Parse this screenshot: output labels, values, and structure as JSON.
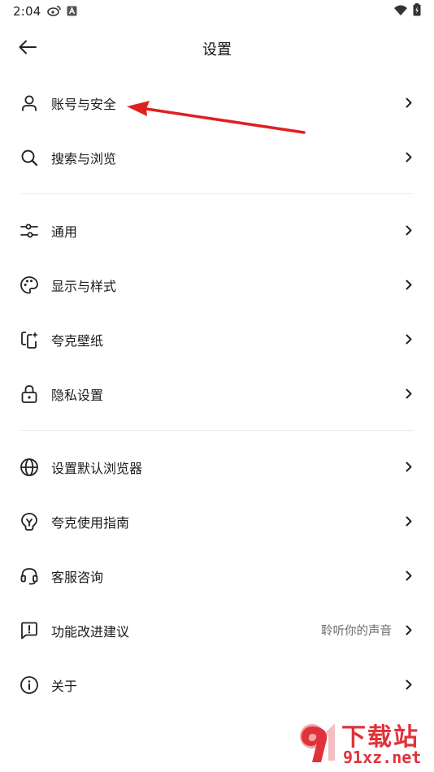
{
  "status_bar": {
    "time": "2:04",
    "icons": [
      "weibo-icon",
      "a-badge-icon",
      "wifi-icon",
      "battery-charging-icon"
    ]
  },
  "header": {
    "title": "设置",
    "back_icon": "arrow-left-icon"
  },
  "groups": [
    {
      "items": [
        {
          "id": "account",
          "label": "账号与安全",
          "icon": "user-icon"
        },
        {
          "id": "search",
          "label": "搜索与浏览",
          "icon": "search-icon"
        }
      ]
    },
    {
      "items": [
        {
          "id": "general",
          "label": "通用",
          "icon": "sliders-icon"
        },
        {
          "id": "display",
          "label": "显示与样式",
          "icon": "palette-icon"
        },
        {
          "id": "wallpaper",
          "label": "夸克壁纸",
          "icon": "wallpaper-icon"
        },
        {
          "id": "privacy",
          "label": "隐私设置",
          "icon": "lock-icon"
        }
      ]
    },
    {
      "items": [
        {
          "id": "default-browser",
          "label": "设置默认浏览器",
          "icon": "globe-icon"
        },
        {
          "id": "guide",
          "label": "夸克使用指南",
          "icon": "lightbulb-icon"
        },
        {
          "id": "support",
          "label": "客服咨询",
          "icon": "headset-icon"
        },
        {
          "id": "feedback",
          "label": "功能改进建议",
          "icon": "feedback-icon",
          "value": "聆听你的声音"
        },
        {
          "id": "about",
          "label": "关于",
          "icon": "info-icon"
        }
      ]
    }
  ],
  "annotation": {
    "color": "#e02020",
    "target": "账号与安全"
  },
  "watermark": {
    "top_text": "下载站",
    "bottom_text": "91xz.net",
    "color": "#e0323b"
  }
}
